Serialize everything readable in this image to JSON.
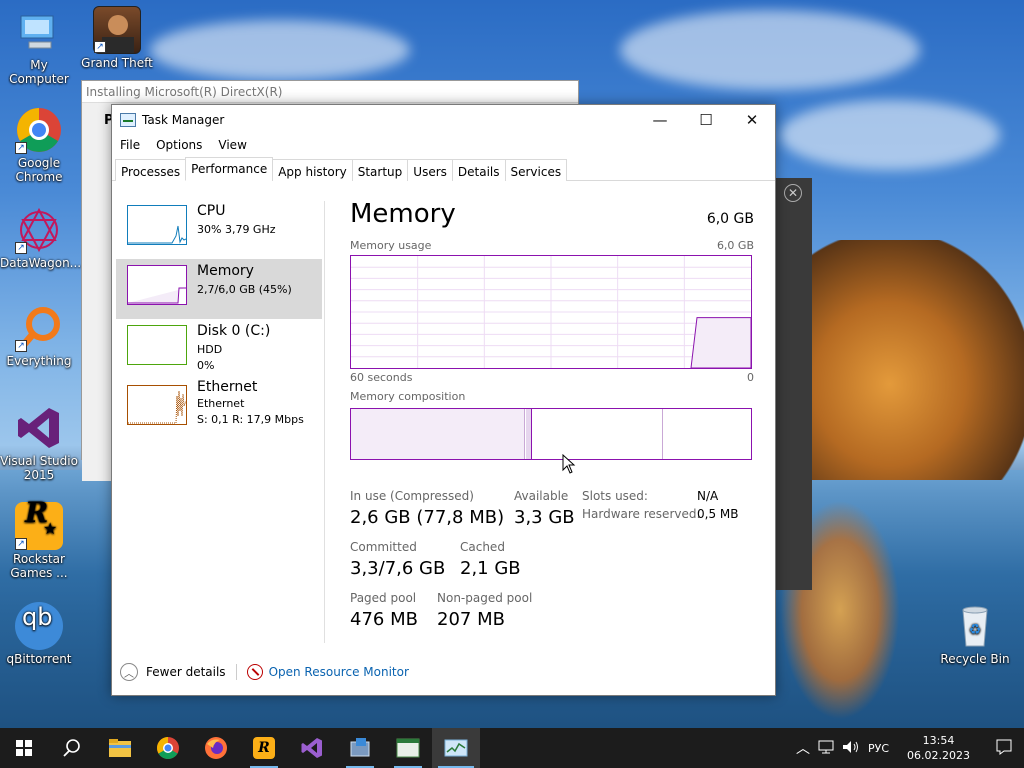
{
  "desktop": {
    "icons": [
      {
        "label": "My Computer"
      },
      {
        "label": "Grand Theft Auto S..."
      },
      {
        "label": "Google Chrome"
      },
      {
        "label": "DataWagon..."
      },
      {
        "label": "Everything"
      },
      {
        "label": "Visual Studio 2015"
      },
      {
        "label": "Rockstar Games ..."
      },
      {
        "label": "qBittorrent"
      },
      {
        "label": "Recycle Bin"
      }
    ],
    "background_window_title": "Installing Microsoft(R) DirectX(R)",
    "background_window_letter": "P"
  },
  "task_manager": {
    "title": "Task Manager",
    "controls": {
      "minimize": "—",
      "maximize": "☐",
      "close": "✕"
    },
    "menu": [
      "File",
      "Options",
      "View"
    ],
    "tabs": [
      "Processes",
      "Performance",
      "App history",
      "Startup",
      "Users",
      "Details",
      "Services"
    ],
    "active_tab": "Performance",
    "sidebar": [
      {
        "name": "CPU",
        "sub1": "30% 3,79 GHz",
        "color": "#117dbb"
      },
      {
        "name": "Memory",
        "sub1": "2,7/6,0 GB (45%)",
        "color": "#8b12ae"
      },
      {
        "name": "Disk 0 (C:)",
        "sub1": "HDD",
        "sub2": "0%",
        "color": "#4da60c"
      },
      {
        "name": "Ethernet",
        "sub1": "Ethernet",
        "sub2": "S: 0,1  R: 17,9 Mbps",
        "color": "#a74f01"
      }
    ],
    "detail": {
      "title": "Memory",
      "total": "6,0 GB",
      "usage_label": "Memory usage",
      "usage_max": "6,0 GB",
      "time_left": "60 seconds",
      "time_right": "0",
      "composition_label": "Memory composition",
      "usage_fraction": 0.45,
      "stats": {
        "in_use_label": "In use (Compressed)",
        "in_use_value": "2,6 GB (77,8 MB)",
        "available_label": "Available",
        "available_value": "3,3 GB",
        "committed_label": "Committed",
        "committed_value": "3,3/7,6 GB",
        "cached_label": "Cached",
        "cached_value": "2,1 GB",
        "paged_label": "Paged pool",
        "paged_value": "476 MB",
        "nonpaged_label": "Non-paged pool",
        "nonpaged_value": "207 MB",
        "slots_label": "Slots used:",
        "slots_value": "N/A",
        "hwres_label": "Hardware reserved:",
        "hwres_value": "0,5 MB"
      }
    },
    "footer": {
      "fewer_details": "Fewer details",
      "resource_monitor": "Open Resource Monitor"
    }
  },
  "taskbar": {
    "items": [
      "start-icon",
      "search-icon",
      "file-explorer-icon",
      "chrome-icon",
      "firefox-icon",
      "rockstar-icon",
      "visual-studio-icon",
      "installer-icon",
      "terminal-icon",
      "task-manager-icon"
    ],
    "language": "РУС",
    "time": "13:54",
    "date": "06.02.2023"
  },
  "colors": {
    "memory_accent": "#8b12ae",
    "cpu_accent": "#117dbb",
    "disk_accent": "#4da60c",
    "ethernet_accent": "#a74f01"
  }
}
